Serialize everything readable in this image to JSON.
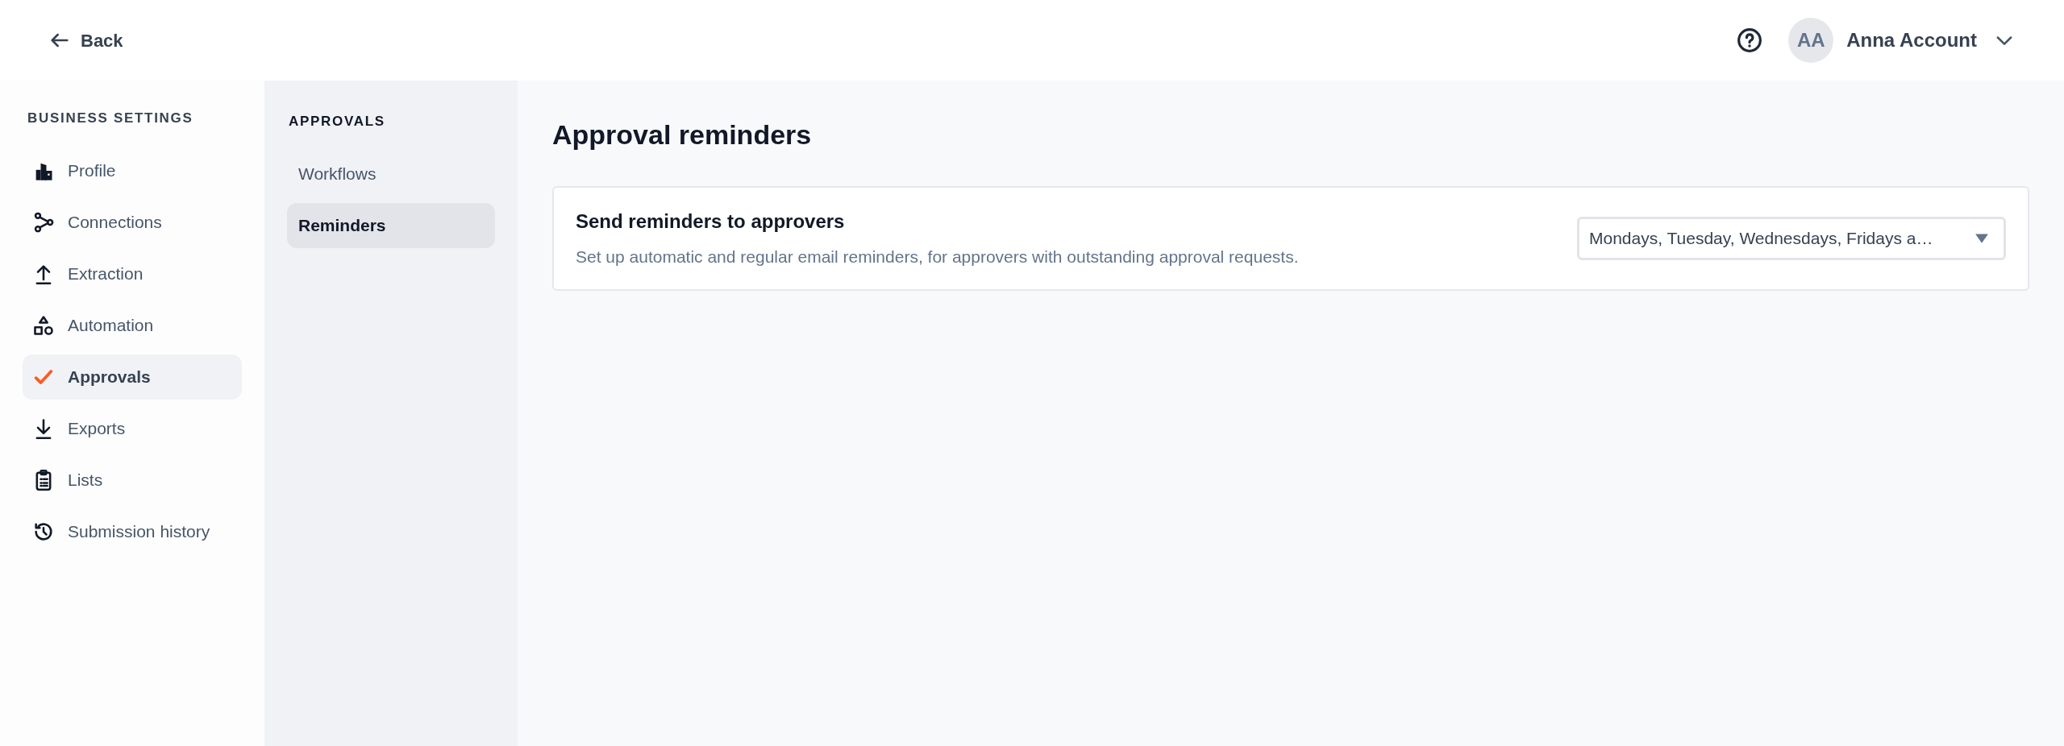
{
  "header": {
    "back": "Back",
    "user": {
      "initials": "AA",
      "name": "Anna Account"
    }
  },
  "sidebar": {
    "title": "BUSINESS SETTINGS",
    "items": [
      {
        "label": "Profile",
        "selected": false
      },
      {
        "label": "Connections",
        "selected": false
      },
      {
        "label": "Extraction",
        "selected": false
      },
      {
        "label": "Automation",
        "selected": false
      },
      {
        "label": "Approvals",
        "selected": true
      },
      {
        "label": "Exports",
        "selected": false
      },
      {
        "label": "Lists",
        "selected": false
      },
      {
        "label": "Submission history",
        "selected": false
      }
    ]
  },
  "subnav": {
    "title": "APPROVALS",
    "items": [
      {
        "label": "Workflows",
        "selected": false
      },
      {
        "label": "Reminders",
        "selected": true
      }
    ]
  },
  "main": {
    "title": "Approval reminders",
    "card": {
      "title": "Send reminders to approvers",
      "description": "Set up automatic and regular email reminders, for approvers with outstanding approval requests.",
      "select_value": "Mondays, Tuesday, Wednesdays, Fridays a…"
    }
  }
}
